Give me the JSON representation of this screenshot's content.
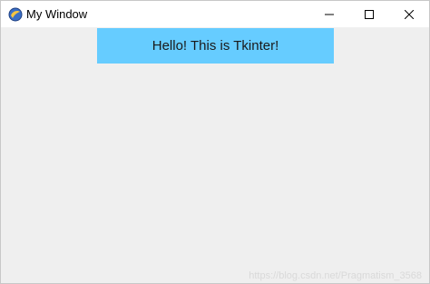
{
  "window": {
    "title": "My Window",
    "icon": "python-feather-icon"
  },
  "title_controls": {
    "minimize_icon": "minimize-icon",
    "maximize_icon": "maximize-icon",
    "close_icon": "close-icon"
  },
  "content": {
    "label_text": "Hello! This is Tkinter!",
    "label_bg": "#66ccff",
    "client_bg": "#efefef"
  },
  "watermark": "https://blog.csdn.net/Pragmatism_3568"
}
